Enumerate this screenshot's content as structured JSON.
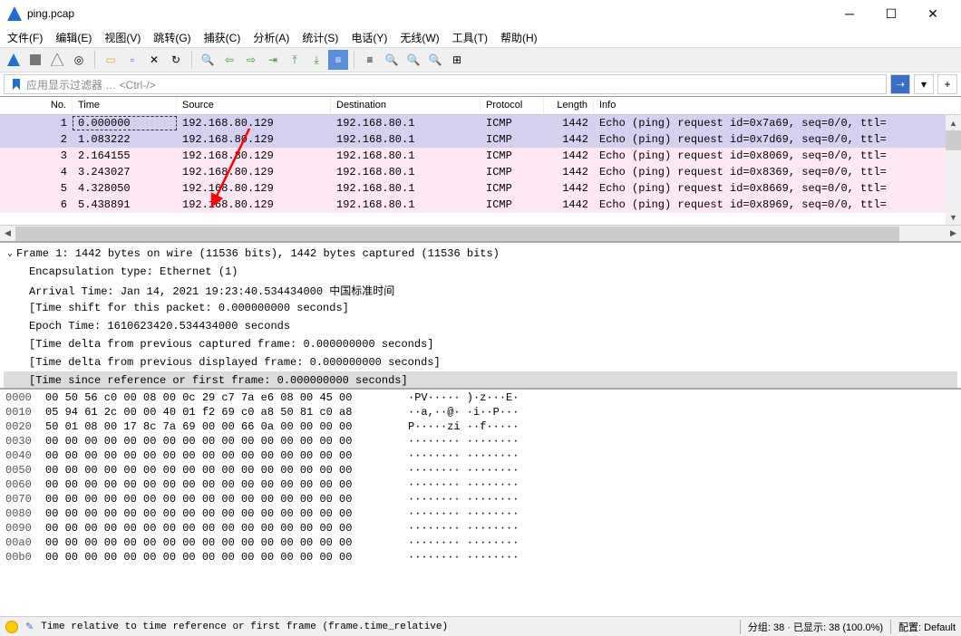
{
  "window": {
    "title": "ping.pcap"
  },
  "menu": {
    "file": "文件(F)",
    "edit": "编辑(E)",
    "view": "视图(V)",
    "go": "跳转(G)",
    "capture": "捕获(C)",
    "analyze": "分析(A)",
    "statistics": "统计(S)",
    "telephony": "电话(Y)",
    "wireless": "无线(W)",
    "tools": "工具(T)",
    "help": "帮助(H)"
  },
  "filter": {
    "placeholder": "应用显示过滤器 … <Ctrl-/>"
  },
  "columns": {
    "no": "No.",
    "time": "Time",
    "source": "Source",
    "dest": "Destination",
    "proto": "Protocol",
    "len": "Length",
    "info": "Info"
  },
  "packets": [
    {
      "no": "1",
      "time": "0.000000",
      "src": "192.168.80.129",
      "dst": "192.168.80.1",
      "proto": "ICMP",
      "len": "1442",
      "info": "Echo (ping) request  id=0x7a69, seq=0/0, ttl=",
      "class": "highlight selected"
    },
    {
      "no": "2",
      "time": "1.083222",
      "src": "192.168.80.129",
      "dst": "192.168.80.1",
      "proto": "ICMP",
      "len": "1442",
      "info": "Echo (ping) request  id=0x7d69, seq=0/0, ttl=",
      "class": "highlight"
    },
    {
      "no": "3",
      "time": "2.164155",
      "src": "192.168.80.129",
      "dst": "192.168.80.1",
      "proto": "ICMP",
      "len": "1442",
      "info": "Echo (ping) request  id=0x8069, seq=0/0, ttl=",
      "class": "pink"
    },
    {
      "no": "4",
      "time": "3.243027",
      "src": "192.168.80.129",
      "dst": "192.168.80.1",
      "proto": "ICMP",
      "len": "1442",
      "info": "Echo (ping) request  id=0x8369, seq=0/0, ttl=",
      "class": "pink"
    },
    {
      "no": "5",
      "time": "4.328050",
      "src": "192.168.80.129",
      "dst": "192.168.80.1",
      "proto": "ICMP",
      "len": "1442",
      "info": "Echo (ping) request  id=0x8669, seq=0/0, ttl=",
      "class": "pink"
    },
    {
      "no": "6",
      "time": "5.438891",
      "src": "192.168.80.129",
      "dst": "192.168.80.1",
      "proto": "ICMP",
      "len": "1442",
      "info": "Echo (ping) request  id=0x8969, seq=0/0, ttl=",
      "class": "pink"
    }
  ],
  "details": {
    "frame": "Frame 1: 1442 bytes on wire (11536 bits), 1442 bytes captured (11536 bits)",
    "encap": "Encapsulation type: Ethernet (1)",
    "arrival": "Arrival Time: Jan 14, 2021 19:23:40.534434000 中国标准时间",
    "shift": "[Time shift for this packet: 0.000000000 seconds]",
    "epoch": "Epoch Time: 1610623420.534434000 seconds",
    "delta_cap": "[Time delta from previous captured frame: 0.000000000 seconds]",
    "delta_disp": "[Time delta from previous displayed frame: 0.000000000 seconds]",
    "since_ref": "[Time since reference or first frame: 0.000000000 seconds]"
  },
  "hex": [
    {
      "off": "0000",
      "bytes": "00 50 56 c0 00 08 00 0c  29 c7 7a e6 08 00 45 00",
      "ascii": "·PV····· )·z···E·"
    },
    {
      "off": "0010",
      "bytes": "05 94 61 2c 00 00 40 01  f2 69 c0 a8 50 81 c0 a8",
      "ascii": "··a,··@· ·i··P···"
    },
    {
      "off": "0020",
      "bytes": "50 01 08 00 17 8c 7a 69  00 00 66 0a 00 00 00 00",
      "ascii": "P·····zi ··f·····"
    },
    {
      "off": "0030",
      "bytes": "00 00 00 00 00 00 00 00  00 00 00 00 00 00 00 00",
      "ascii": "········ ········"
    },
    {
      "off": "0040",
      "bytes": "00 00 00 00 00 00 00 00  00 00 00 00 00 00 00 00",
      "ascii": "········ ········"
    },
    {
      "off": "0050",
      "bytes": "00 00 00 00 00 00 00 00  00 00 00 00 00 00 00 00",
      "ascii": "········ ········"
    },
    {
      "off": "0060",
      "bytes": "00 00 00 00 00 00 00 00  00 00 00 00 00 00 00 00",
      "ascii": "········ ········"
    },
    {
      "off": "0070",
      "bytes": "00 00 00 00 00 00 00 00  00 00 00 00 00 00 00 00",
      "ascii": "········ ········"
    },
    {
      "off": "0080",
      "bytes": "00 00 00 00 00 00 00 00  00 00 00 00 00 00 00 00",
      "ascii": "········ ········"
    },
    {
      "off": "0090",
      "bytes": "00 00 00 00 00 00 00 00  00 00 00 00 00 00 00 00",
      "ascii": "········ ········"
    },
    {
      "off": "00a0",
      "bytes": "00 00 00 00 00 00 00 00  00 00 00 00 00 00 00 00",
      "ascii": "········ ········"
    },
    {
      "off": "00b0",
      "bytes": "00 00 00 00 00 00 00 00  00 00 00 00 00 00 00 00",
      "ascii": "········ ········"
    }
  ],
  "status": {
    "text": "Time relative to time reference or first frame (frame.time_relative)",
    "packets": "分组: 38 · 已显示: 38 (100.0%)",
    "profile": "配置: Default"
  }
}
